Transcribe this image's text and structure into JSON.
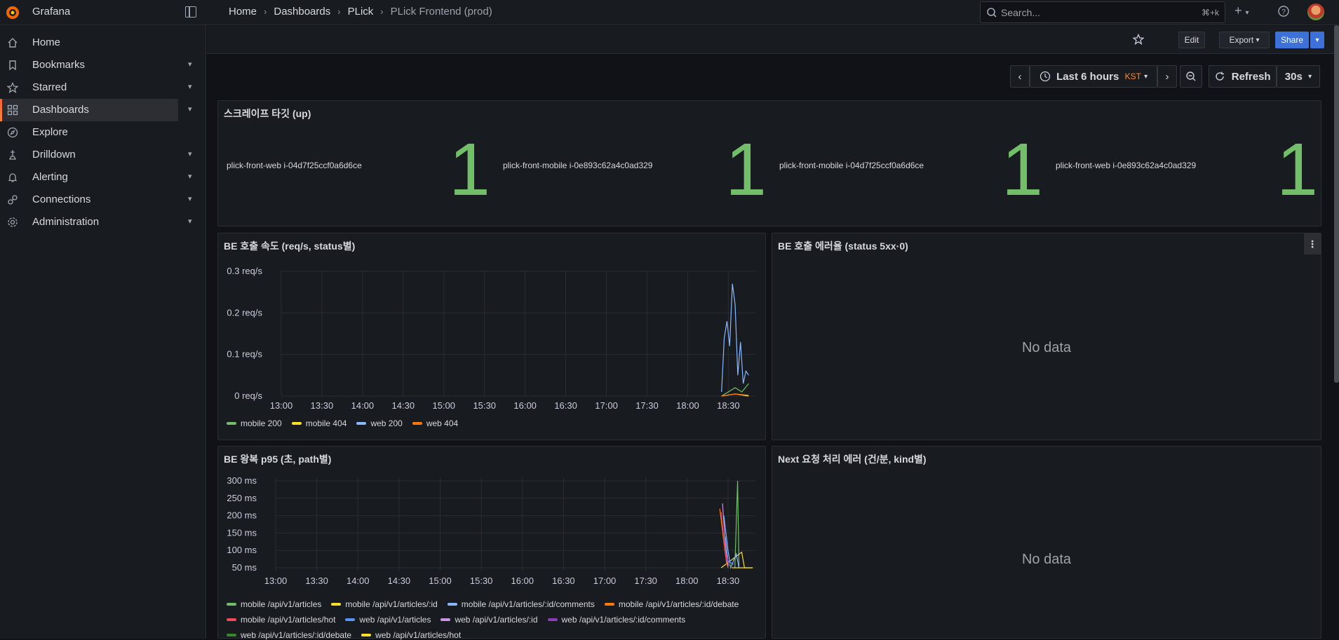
{
  "app": {
    "brand": "Grafana"
  },
  "breadcrumbs": [
    "Home",
    "Dashboards",
    "PLick",
    "PLick Frontend (prod)"
  ],
  "search": {
    "placeholder": "Search...",
    "shortcut": "⌘+k"
  },
  "sidebar": {
    "items": [
      {
        "label": "Home",
        "icon": "home-icon",
        "expandable": false
      },
      {
        "label": "Bookmarks",
        "icon": "bookmark-icon",
        "expandable": true
      },
      {
        "label": "Starred",
        "icon": "star-icon",
        "expandable": true
      },
      {
        "label": "Dashboards",
        "icon": "dashboards-icon",
        "expandable": true,
        "active": true
      },
      {
        "label": "Explore",
        "icon": "compass-icon",
        "expandable": false
      },
      {
        "label": "Drilldown",
        "icon": "drilldown-icon",
        "expandable": true
      },
      {
        "label": "Alerting",
        "icon": "bell-icon",
        "expandable": true
      },
      {
        "label": "Connections",
        "icon": "connections-icon",
        "expandable": true
      },
      {
        "label": "Administration",
        "icon": "gear-icon",
        "expandable": true
      }
    ]
  },
  "toolbar": {
    "edit": "Edit",
    "export": "Export",
    "share": "Share"
  },
  "timepicker": {
    "range": "Last 6 hours",
    "tz": "KST",
    "refresh": "Refresh",
    "interval": "30s"
  },
  "colors": {
    "accent": "#3d71d9",
    "stat": "#73bf69",
    "green": "#73bf69",
    "yellow": "#fade2a",
    "blue": "#8ab8ff",
    "orange": "#ff780a",
    "red": "#f2495c",
    "purple": "#ca95e5"
  },
  "panels": {
    "stat": {
      "title": "스크레이프 타깃 (up)",
      "items": [
        {
          "label": "plick-front-web i-04d7f25ccf0a6d6ce",
          "value": "1"
        },
        {
          "label": "plick-front-mobile i-0e893c62a4c0ad329",
          "value": "1"
        },
        {
          "label": "plick-front-mobile i-04d7f25ccf0a6d6ce",
          "value": "1"
        },
        {
          "label": "plick-front-web i-0e893c62a4c0ad329",
          "value": "1"
        }
      ]
    },
    "be_rate": {
      "title": "BE 호출 속도 (req/s, status별)"
    },
    "be_error": {
      "title": "BE 호출 에러율 (status 5xx·0)",
      "nodata": "No data"
    },
    "be_p95": {
      "title": "BE 왕복 p95 (초, path별)"
    },
    "next_error": {
      "title": "Next 요청 처리 에러 (건/분, kind별)",
      "nodata": "No data"
    }
  },
  "chart_data": [
    {
      "type": "line",
      "title": "BE 호출 속도 (req/s, status별)",
      "x_ticks": [
        "13:00",
        "13:30",
        "14:00",
        "14:30",
        "15:00",
        "15:30",
        "16:00",
        "16:30",
        "17:00",
        "17:30",
        "18:00",
        "18:30"
      ],
      "y_ticks": [
        "0 req/s",
        "0.1 req/s",
        "0.2 req/s",
        "0.3 req/s"
      ],
      "ylim": [
        0,
        0.3
      ],
      "series": [
        {
          "name": "mobile 200",
          "color": "#73bf69",
          "points": [
            [
              "18:25",
              0.0
            ],
            [
              "18:30",
              0.01
            ],
            [
              "18:35",
              0.02
            ],
            [
              "18:40",
              0.01
            ],
            [
              "18:45",
              0.03
            ]
          ]
        },
        {
          "name": "mobile 404",
          "color": "#fade2a",
          "points": [
            [
              "18:25",
              0.0
            ],
            [
              "18:35",
              0.005
            ],
            [
              "18:45",
              0.0
            ]
          ]
        },
        {
          "name": "web 200",
          "color": "#8ab8ff",
          "points": [
            [
              "18:25",
              0.01
            ],
            [
              "18:27",
              0.14
            ],
            [
              "18:29",
              0.18
            ],
            [
              "18:31",
              0.12
            ],
            [
              "18:33",
              0.27
            ],
            [
              "18:35",
              0.22
            ],
            [
              "18:37",
              0.05
            ],
            [
              "18:39",
              0.13
            ],
            [
              "18:41",
              0.03
            ],
            [
              "18:43",
              0.06
            ],
            [
              "18:45",
              0.05
            ]
          ]
        },
        {
          "name": "web 404",
          "color": "#ff780a",
          "points": [
            [
              "18:25",
              0.0
            ],
            [
              "18:35",
              0.005
            ],
            [
              "18:45",
              0.002
            ]
          ]
        }
      ]
    },
    {
      "type": "line",
      "title": "BE 왕복 p95 (초, path별)",
      "x_ticks": [
        "13:00",
        "13:30",
        "14:00",
        "14:30",
        "15:00",
        "15:30",
        "16:00",
        "16:30",
        "17:00",
        "17:30",
        "18:00",
        "18:30"
      ],
      "y_ticks": [
        "50 ms",
        "100 ms",
        "150 ms",
        "200 ms",
        "250 ms",
        "300 ms"
      ],
      "ylim": [
        40,
        310
      ],
      "series": [
        {
          "name": "mobile /api/v1/articles",
          "color": "#73bf69",
          "points": [
            [
              "18:35",
              50
            ],
            [
              "18:37",
              300
            ],
            [
              "18:38",
              50
            ]
          ]
        },
        {
          "name": "mobile /api/v1/articles/:id",
          "color": "#fade2a",
          "points": [
            [
              "18:25",
              50
            ],
            [
              "18:40",
              95
            ],
            [
              "18:42",
              50
            ],
            [
              "18:48",
              50
            ]
          ]
        },
        {
          "name": "mobile /api/v1/articles/:id/comments",
          "color": "#8ab8ff",
          "points": [
            [
              "18:27",
              200
            ],
            [
              "18:30",
              100
            ],
            [
              "18:32",
              50
            ],
            [
              "18:36",
              90
            ],
            [
              "18:38",
              50
            ]
          ]
        },
        {
          "name": "mobile /api/v1/articles/:id/debate",
          "color": "#ff780a",
          "points": [
            [
              "18:24",
              220
            ],
            [
              "18:28",
              90
            ],
            [
              "18:30",
              50
            ]
          ]
        },
        {
          "name": "mobile /api/v1/articles/hot",
          "color": "#f2495c",
          "points": [
            [
              "18:25",
              210
            ],
            [
              "18:27",
              130
            ],
            [
              "18:29",
              60
            ]
          ]
        },
        {
          "name": "web /api/v1/articles",
          "color": "#5794f2",
          "points": [
            [
              "18:28",
              140
            ],
            [
              "18:30",
              70
            ],
            [
              "18:34",
              60
            ]
          ]
        },
        {
          "name": "web /api/v1/articles/:id",
          "color": "#ca95e5",
          "points": [
            [
              "18:26",
              235
            ],
            [
              "18:28",
              120
            ],
            [
              "18:30",
              55
            ]
          ]
        },
        {
          "name": "web /api/v1/articles/:id/comments",
          "color": "#8f3bb8",
          "points": [
            [
              "18:29",
              80
            ],
            [
              "18:31",
              55
            ]
          ]
        },
        {
          "name": "web /api/v1/articles/:id/debate",
          "color": "#37872d",
          "points": [
            [
              "18:31",
              65
            ],
            [
              "18:33",
              50
            ]
          ]
        },
        {
          "name": "web /api/v1/articles/hot",
          "color": "#fade2a",
          "points": [
            [
              "18:33",
              50
            ],
            [
              "18:48",
              50
            ]
          ]
        }
      ]
    }
  ]
}
